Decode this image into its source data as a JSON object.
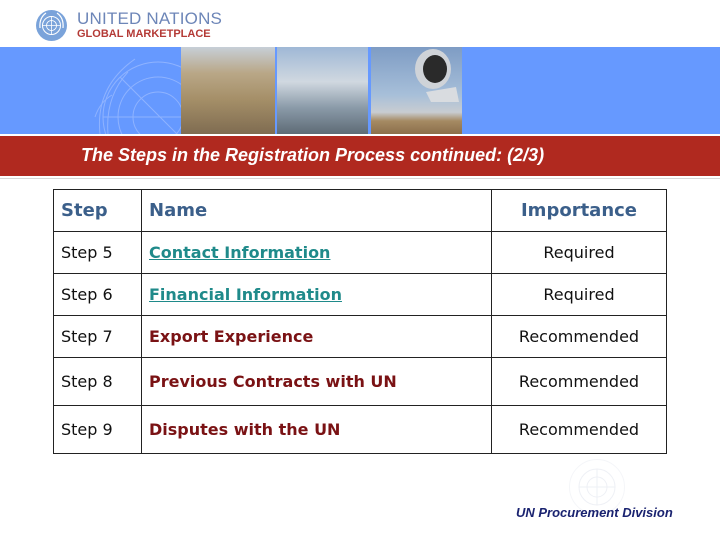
{
  "header": {
    "logo_line1": "UNITED NATIONS",
    "logo_line2": "GLOBAL MARKETPLACE",
    "logo_icon": "un-emblem-icon"
  },
  "banner": {
    "photos": [
      "man-with-boxes-photo",
      "truck-loading-cargo-plane-photo",
      "jet-engine-airfield-photo"
    ],
    "colors": {
      "blue": "#6699ff",
      "title_bar": "#b0291f"
    }
  },
  "title": "The Steps in the Registration Process continued: (2/3)",
  "table": {
    "headers": [
      "Step",
      "Name",
      "Importance"
    ],
    "rows": [
      {
        "step": "Step 5",
        "name": "Contact Information",
        "importance": "Required",
        "link": true
      },
      {
        "step": "Step 6",
        "name": "Financial Information",
        "importance": "Required",
        "link": true
      },
      {
        "step": "Step 7",
        "name": "Export Experience",
        "importance": "Recommended",
        "link": false
      },
      {
        "step": "Step 8",
        "name": "Previous Contracts with UN",
        "importance": "Recommended",
        "link": false
      },
      {
        "step": "Step 9",
        "name": "Disputes with the UN",
        "importance": "Recommended",
        "link": false
      }
    ]
  },
  "footer": {
    "text": "UN Procurement Division",
    "emblem_icon": "un-emblem-watermark-icon"
  }
}
